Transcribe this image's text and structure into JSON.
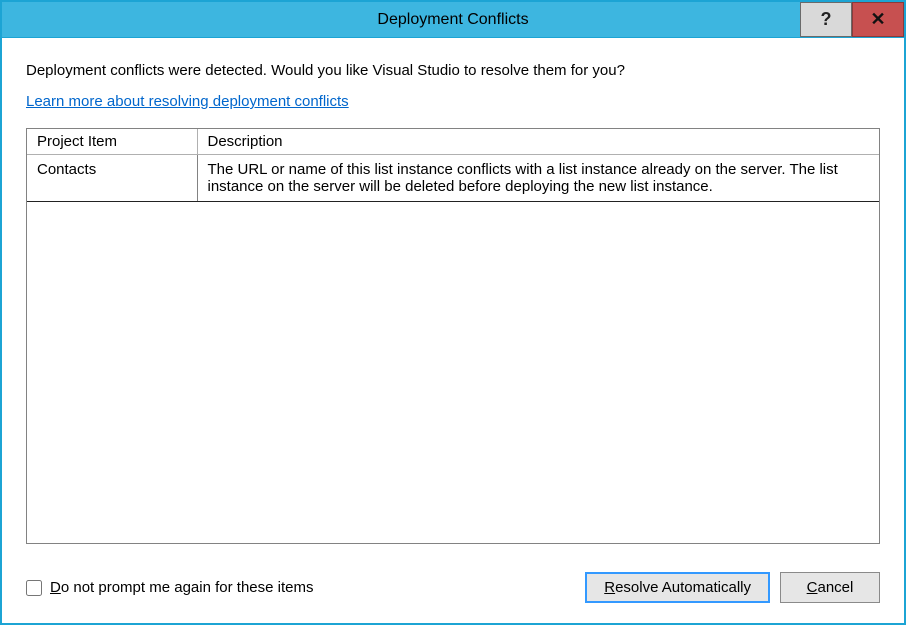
{
  "titlebar": {
    "title": "Deployment Conflicts",
    "help_symbol": "?",
    "close_symbol": "✕"
  },
  "main": {
    "intro": "Deployment conflicts were detected. Would you like Visual Studio to resolve them for you?",
    "link": "Learn more about resolving deployment conflicts",
    "columns": {
      "project": "Project Item",
      "description": "Description"
    },
    "rows": [
      {
        "project": "Contacts",
        "description": "The URL or name of this list instance conflicts with a list instance already on the server. The list instance on the server will be deleted before deploying the new list instance."
      }
    ]
  },
  "footer": {
    "checkbox_label_pre": "D",
    "checkbox_label_rest": "o not prompt me again for these items",
    "resolve_label_pre": "R",
    "resolve_label_rest": "esolve Automatically",
    "cancel_label_pre": "C",
    "cancel_label_rest": "ancel"
  }
}
